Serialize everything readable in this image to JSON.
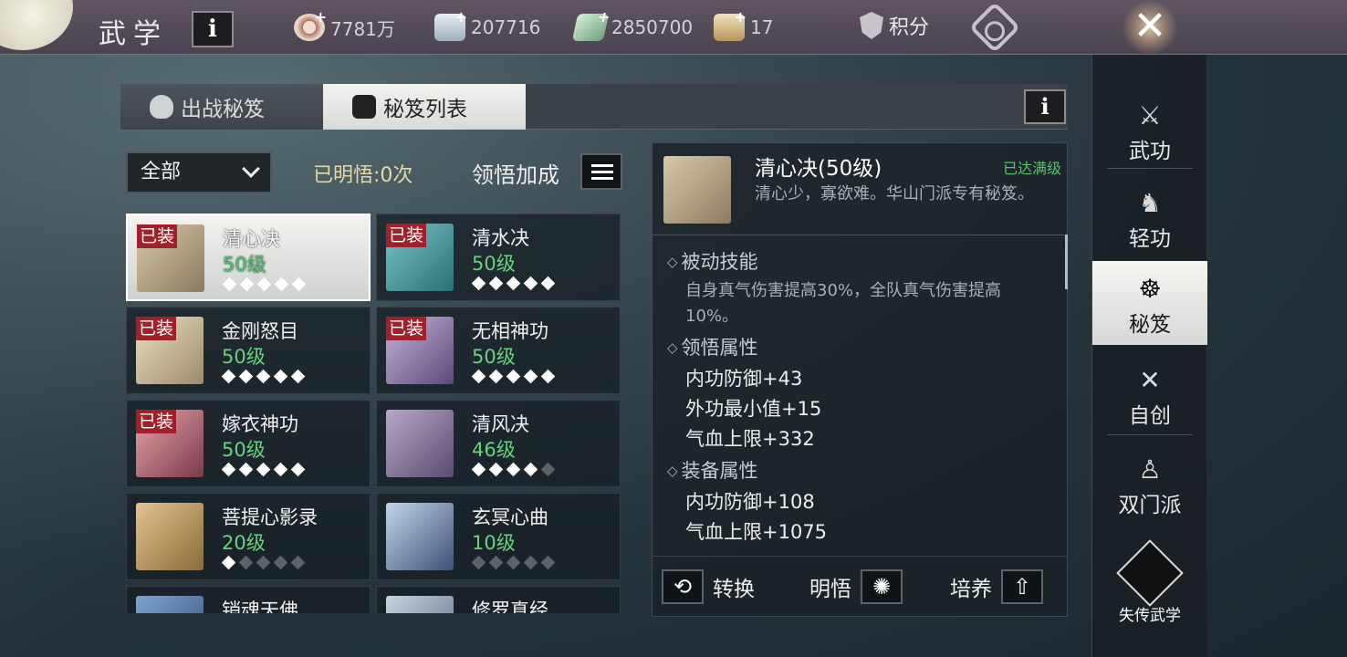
{
  "header": {
    "title": "武学",
    "info_label": "i",
    "resources": [
      {
        "icon": "copper-coin-icon",
        "value": "7781万"
      },
      {
        "icon": "silver-ingot-icon",
        "value": "207716"
      },
      {
        "icon": "jade-ticket-icon",
        "value": "2850700"
      },
      {
        "icon": "gold-ingot-icon",
        "value": "17"
      }
    ],
    "score_label": "积分",
    "close_label": "✕"
  },
  "tabs": {
    "deploy": "出战秘笈",
    "list": "秘笈列表",
    "info_label": "i"
  },
  "filter": {
    "selected": "全部",
    "enlightened": "已明悟:0次",
    "bonus_label": "领悟加成"
  },
  "cards": [
    {
      "name": "清心决",
      "level": "50级",
      "equipped": "已装",
      "stars_on": 5,
      "selected": true
    },
    {
      "name": "清水决",
      "level": "50级",
      "equipped": "已装",
      "stars_on": 5
    },
    {
      "name": "金刚怒目",
      "level": "50级",
      "equipped": "已装",
      "stars_on": 5
    },
    {
      "name": "无相神功",
      "level": "50级",
      "equipped": "已装",
      "stars_on": 5
    },
    {
      "name": "嫁衣神功",
      "level": "50级",
      "equipped": "已装",
      "stars_on": 5
    },
    {
      "name": "清风决",
      "level": "46级",
      "equipped": "",
      "stars_on": 4
    },
    {
      "name": "菩提心影录",
      "level": "20级",
      "equipped": "",
      "stars_on": 1
    },
    {
      "name": "玄冥心曲",
      "level": "10级",
      "equipped": "",
      "stars_on": 0
    },
    {
      "name": "销魂天佛",
      "level": "",
      "equipped": "",
      "stars_on": 0
    },
    {
      "name": "修罗真经",
      "level": "",
      "equipped": "",
      "stars_on": 0
    }
  ],
  "detail": {
    "name": "清心决(50级)",
    "status": "已达满级",
    "description": "清心少，寡欲难。华山门派专有秘笈。",
    "passive_title": "被动技能",
    "passive_desc": "自身真气伤害提高30%，全队真气伤害提高10%。",
    "enlight_title": "领悟属性",
    "enlight_stats": [
      "内功防御+43",
      "外功最小值+15",
      "气血上限+332"
    ],
    "equip_title": "装备属性",
    "equip_stats": [
      "内功防御+108",
      "气血上限+1075"
    ],
    "actions": {
      "convert": "转换",
      "enlighten": "明悟",
      "cultivate": "培养"
    }
  },
  "sidenav": {
    "items": [
      "武功",
      "轻功",
      "秘笈",
      "自创",
      "双门派"
    ],
    "active_index": 2,
    "special": "失传武学"
  }
}
